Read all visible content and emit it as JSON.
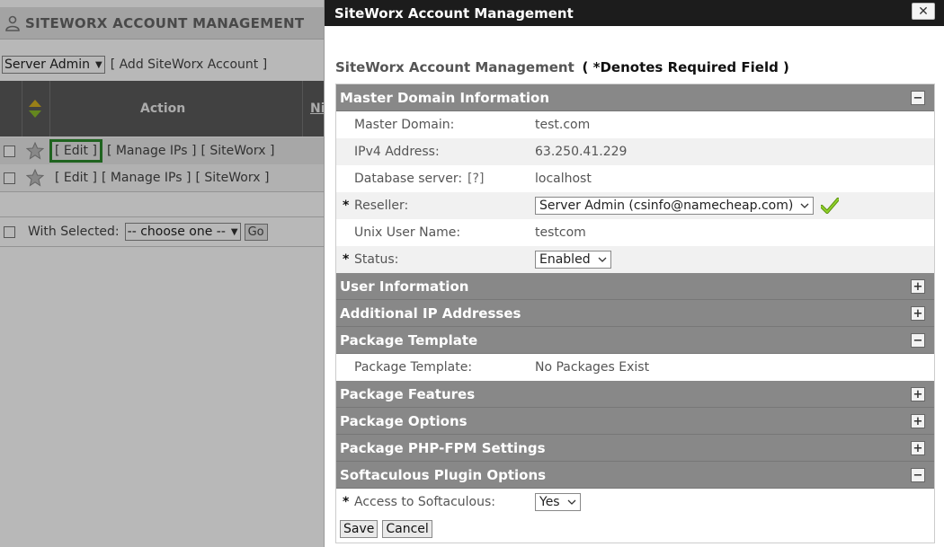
{
  "background": {
    "title": "SITEWORX ACCOUNT MANAGEMENT",
    "toolbar": {
      "owner_select": "Server Admin",
      "add_link": "[ Add SiteWorx Account ]"
    },
    "table_header": {
      "action": "Action",
      "ni": "Ni"
    },
    "rows": [
      {
        "edit": "[ Edit ]",
        "manage_ips": "[ Manage IPs ]",
        "siteworx": "[ SiteWorx ]"
      },
      {
        "edit": "[ Edit ]",
        "manage_ips": "[ Manage IPs ]",
        "siteworx": "[ SiteWorx ]"
      }
    ],
    "footer": {
      "with_selected": "With Selected:",
      "choose": "-- choose one --",
      "go": "Go"
    }
  },
  "modal": {
    "title": "SiteWorx Account Management",
    "close": "✕",
    "form_title": "SiteWorx Account Management",
    "required_note": "( *Denotes Required Field )",
    "sections": {
      "master": {
        "title": "Master Domain Information",
        "toggle": "−",
        "fields": {
          "domain_label": "Master Domain:",
          "domain_value": "test.com",
          "ipv4_label": "IPv4 Address:",
          "ipv4_value": "63.250.41.229",
          "db_label": "Database server:",
          "db_help": "[?]",
          "db_value": "localhost",
          "reseller_label": "Reseller:",
          "reseller_value": "Server Admin (csinfo@namecheap.com)",
          "unix_label": "Unix User Name:",
          "unix_value": "testcom",
          "status_label": "Status:",
          "status_value": "Enabled"
        }
      },
      "user": {
        "title": "User Information",
        "toggle": "+"
      },
      "additional_ip": {
        "title": "Additional IP Addresses",
        "toggle": "+"
      },
      "package_template": {
        "title": "Package Template",
        "toggle": "−",
        "label": "Package Template:",
        "value": "No Packages Exist"
      },
      "package_features": {
        "title": "Package Features",
        "toggle": "+"
      },
      "package_options": {
        "title": "Package Options",
        "toggle": "+"
      },
      "php_fpm": {
        "title": "Package PHP-FPM Settings",
        "toggle": "+"
      },
      "softaculous": {
        "title": "Softaculous Plugin Options",
        "toggle": "−",
        "label": "Access to Softaculous:",
        "value": "Yes"
      }
    },
    "required_mark": "*",
    "buttons": {
      "save": "Save",
      "cancel": "Cancel"
    }
  },
  "colors": {
    "section_header": "#888888",
    "titlebar": "#1c1c1c",
    "highlight": "#2b8a2b",
    "check": "#7fc01b"
  }
}
